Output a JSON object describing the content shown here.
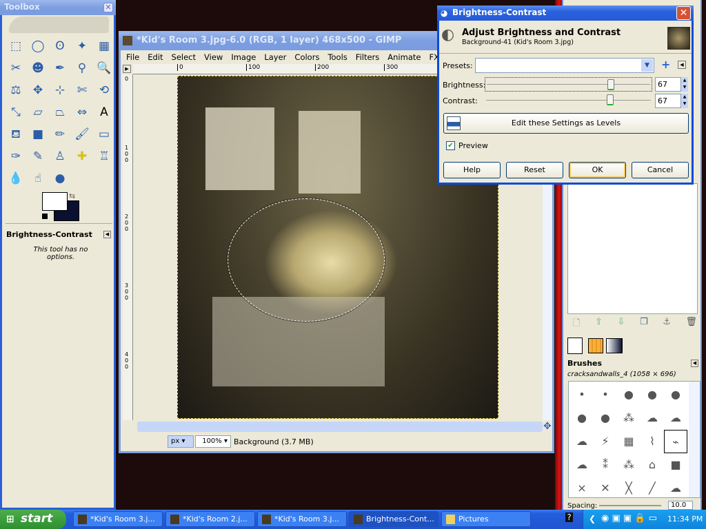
{
  "toolbox": {
    "title": "Toolbox",
    "tools": [
      "rect-select",
      "ellipse-select",
      "free-select",
      "fuzzy-select",
      "select-by-color",
      "scissors",
      "foreground-select",
      "paths",
      "color-picker",
      "zoom",
      "measure",
      "move",
      "align",
      "crop",
      "rotate",
      "scale",
      "shear",
      "perspective",
      "flip",
      "text",
      "bucket-fill",
      "blend",
      "pencil",
      "paintbrush",
      "eraser",
      "airbrush",
      "ink",
      "clone",
      "heal",
      "perspective-clone",
      "blur",
      "smudge",
      "dodge-burn"
    ],
    "fg_color": "#ffffff",
    "bg_color": "#0a1030",
    "options_title": "Brightness-Contrast",
    "options_text": "This tool has no options."
  },
  "image_window": {
    "title": "*Kid's Room 3.jpg-6.0 (RGB, 1 layer) 468x500 - GIMP",
    "menu": [
      "File",
      "Edit",
      "Select",
      "View",
      "Image",
      "Layer",
      "Colors",
      "Tools",
      "Filters",
      "Animate",
      "FX-Found"
    ],
    "hruler": [
      "0",
      "100",
      "200",
      "300"
    ],
    "vruler": [
      "0",
      "100",
      "200",
      "300",
      "400"
    ],
    "unit": "px",
    "zoom": "100%",
    "status": "Background (3.7 MB)"
  },
  "dialog": {
    "title": "Brightness-Contrast",
    "heading": "Adjust Brightness and Contrast",
    "subheading": "Background-41 (Kid's Room 3.jpg)",
    "presets_label": "Presets:",
    "presets_value": "",
    "brightness_label": "Brightness:",
    "brightness": 67,
    "contrast_label": "Contrast:",
    "contrast": 67,
    "slider_range": [
      -127,
      127
    ],
    "levels_button": "Edit these Settings as Levels",
    "preview_label": "Preview",
    "preview_checked": true,
    "buttons": {
      "help": "Help",
      "reset": "Reset",
      "ok": "OK",
      "cancel": "Cancel"
    }
  },
  "dock": {
    "brushes_title": "Brushes",
    "brush_name": "cracksandwalls_4 (1058 × 696)",
    "spacing_label": "Spacing:",
    "spacing": "10.0"
  },
  "taskbar": {
    "start": "start",
    "items": [
      "*Kid's Room 3.j...",
      "*Kid's Room 2.j...",
      "*Kid's Room 3.j...",
      "Brightness-Cont...",
      "Pictures"
    ],
    "active_index": 3,
    "clock": "11:34 PM"
  }
}
